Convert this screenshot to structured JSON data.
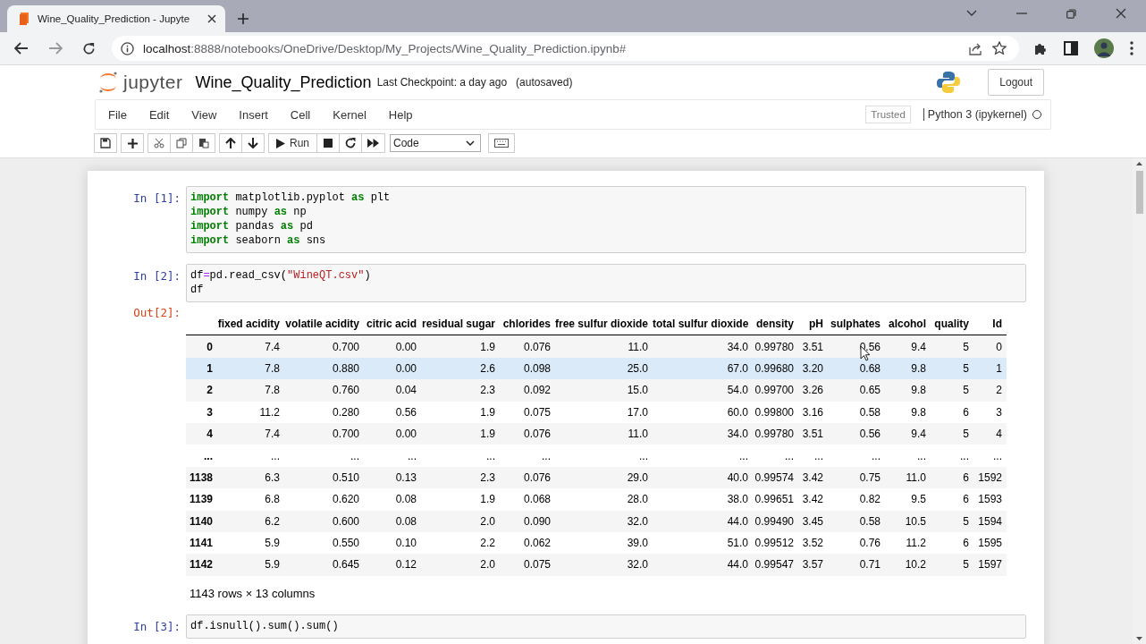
{
  "browser": {
    "tab_title": "Wine_Quality_Prediction - Jupyte",
    "url_host": "localhost",
    "url_path": ":8888/notebooks/OneDrive/Desktop/My_Projects/Wine_Quality_Prediction.ipynb#"
  },
  "header": {
    "logo_text": "jupyter",
    "notebook_name": "Wine_Quality_Prediction",
    "checkpoint": "Last Checkpoint: a day ago",
    "autosave": "(autosaved)",
    "logout": "Logout"
  },
  "menu": [
    "File",
    "Edit",
    "View",
    "Insert",
    "Cell",
    "Kernel",
    "Help"
  ],
  "trusted": "Trusted",
  "kernel": {
    "name": "Python 3 (ipykernel)",
    "busy": false
  },
  "toolbar": {
    "run": "Run",
    "cell_type": "Code"
  },
  "cells": [
    {
      "prompt": "In [1]:",
      "lines": [
        [
          {
            "kind": "kw",
            "text": "import"
          },
          {
            "kind": "plain",
            "text": " matplotlib.pyplot "
          },
          {
            "kind": "kw",
            "text": "as"
          },
          {
            "kind": "plain",
            "text": " plt"
          }
        ],
        [
          {
            "kind": "kw",
            "text": "import"
          },
          {
            "kind": "plain",
            "text": " numpy "
          },
          {
            "kind": "kw",
            "text": "as"
          },
          {
            "kind": "plain",
            "text": " np"
          }
        ],
        [
          {
            "kind": "kw",
            "text": "import"
          },
          {
            "kind": "plain",
            "text": " pandas "
          },
          {
            "kind": "kw",
            "text": "as"
          },
          {
            "kind": "plain",
            "text": " pd"
          }
        ],
        [
          {
            "kind": "kw",
            "text": "import"
          },
          {
            "kind": "plain",
            "text": " seaborn "
          },
          {
            "kind": "kw",
            "text": "as"
          },
          {
            "kind": "plain",
            "text": " sns"
          }
        ]
      ]
    },
    {
      "prompt": "In [2]:",
      "lines": [
        [
          {
            "kind": "plain",
            "text": "df"
          },
          {
            "kind": "op",
            "text": "="
          },
          {
            "kind": "plain",
            "text": "pd.read_csv("
          },
          {
            "kind": "str",
            "text": "\"WineQT.csv\""
          },
          {
            "kind": "plain",
            "text": ")"
          }
        ],
        [
          {
            "kind": "plain",
            "text": "df"
          }
        ]
      ],
      "output": {
        "prompt": "Out[2]:",
        "columns": [
          "fixed acidity",
          "volatile acidity",
          "citric acid",
          "residual sugar",
          "chlorides",
          "free sulfur dioxide",
          "total sulfur dioxide",
          "density",
          "pH",
          "sulphates",
          "alcohol",
          "quality",
          "Id"
        ],
        "rows": [
          {
            "index": "0",
            "hovered": false,
            "cells": [
              "7.4",
              "0.700",
              "0.00",
              "1.9",
              "0.076",
              "11.0",
              "34.0",
              "0.99780",
              "3.51",
              "0.56",
              "9.4",
              "5",
              "0"
            ]
          },
          {
            "index": "1",
            "hovered": true,
            "cells": [
              "7.8",
              "0.880",
              "0.00",
              "2.6",
              "0.098",
              "25.0",
              "67.0",
              "0.99680",
              "3.20",
              "0.68",
              "9.8",
              "5",
              "1"
            ]
          },
          {
            "index": "2",
            "hovered": false,
            "cells": [
              "7.8",
              "0.760",
              "0.04",
              "2.3",
              "0.092",
              "15.0",
              "54.0",
              "0.99700",
              "3.26",
              "0.65",
              "9.8",
              "5",
              "2"
            ]
          },
          {
            "index": "3",
            "hovered": false,
            "cells": [
              "11.2",
              "0.280",
              "0.56",
              "1.9",
              "0.075",
              "17.0",
              "60.0",
              "0.99800",
              "3.16",
              "0.58",
              "9.8",
              "6",
              "3"
            ]
          },
          {
            "index": "4",
            "hovered": false,
            "cells": [
              "7.4",
              "0.700",
              "0.00",
              "1.9",
              "0.076",
              "11.0",
              "34.0",
              "0.99780",
              "3.51",
              "0.56",
              "9.4",
              "5",
              "4"
            ]
          },
          {
            "index": "...",
            "hovered": false,
            "cells": [
              "...",
              "...",
              "...",
              "...",
              "...",
              "...",
              "...",
              "...",
              "...",
              "...",
              "...",
              "...",
              "..."
            ]
          },
          {
            "index": "1138",
            "hovered": false,
            "cells": [
              "6.3",
              "0.510",
              "0.13",
              "2.3",
              "0.076",
              "29.0",
              "40.0",
              "0.99574",
              "3.42",
              "0.75",
              "11.0",
              "6",
              "1592"
            ]
          },
          {
            "index": "1139",
            "hovered": false,
            "cells": [
              "6.8",
              "0.620",
              "0.08",
              "1.9",
              "0.068",
              "28.0",
              "38.0",
              "0.99651",
              "3.42",
              "0.82",
              "9.5",
              "6",
              "1593"
            ]
          },
          {
            "index": "1140",
            "hovered": false,
            "cells": [
              "6.2",
              "0.600",
              "0.08",
              "2.0",
              "0.090",
              "32.0",
              "44.0",
              "0.99490",
              "3.45",
              "0.58",
              "10.5",
              "5",
              "1594"
            ]
          },
          {
            "index": "1141",
            "hovered": false,
            "cells": [
              "5.9",
              "0.550",
              "0.10",
              "2.2",
              "0.062",
              "39.0",
              "51.0",
              "0.99512",
              "3.52",
              "0.76",
              "11.2",
              "6",
              "1595"
            ]
          },
          {
            "index": "1142",
            "hovered": false,
            "cells": [
              "5.9",
              "0.645",
              "0.12",
              "2.0",
              "0.075",
              "32.0",
              "44.0",
              "0.99547",
              "3.57",
              "0.71",
              "10.2",
              "5",
              "1597"
            ]
          }
        ],
        "footer": "1143 rows × 13 columns"
      }
    },
    {
      "prompt": "In [3]:",
      "lines": [
        [
          {
            "kind": "plain",
            "text": "df.isnull().sum().sum()"
          }
        ]
      ]
    }
  ]
}
